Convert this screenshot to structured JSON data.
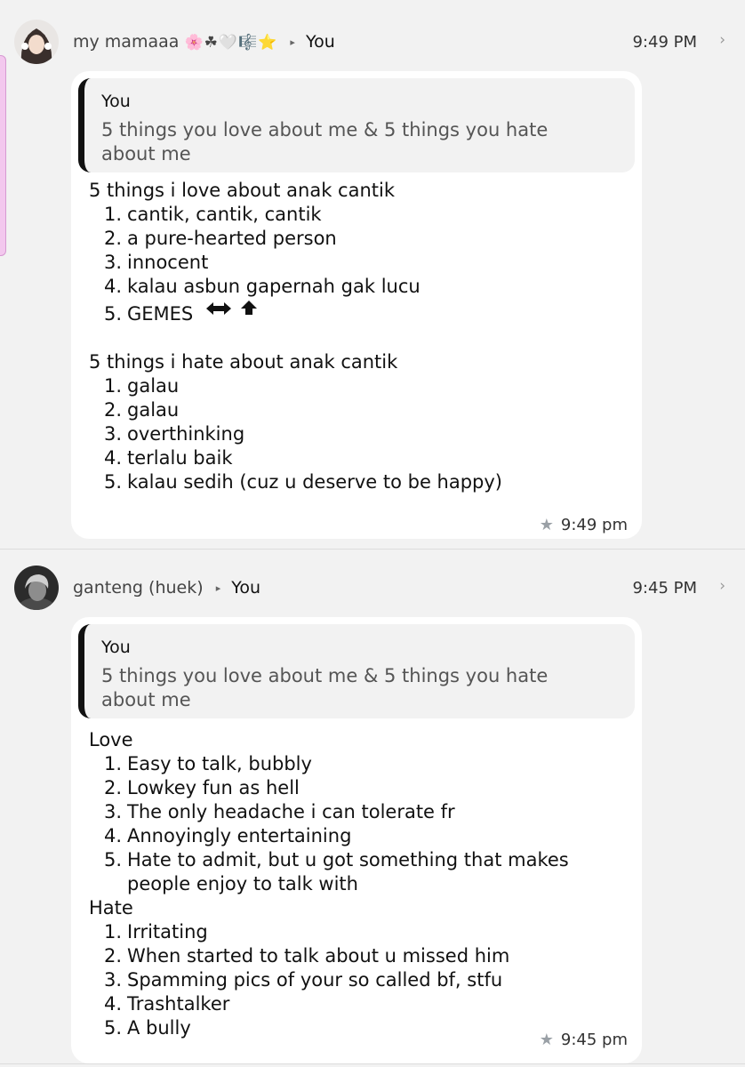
{
  "messages": [
    {
      "sender": "my mamaaa",
      "sender_emoji": "🌸☘🤍🎼⭐",
      "recipient": "You",
      "time": "9:49 PM",
      "quote": {
        "author": "You",
        "text": "5 things you love about me & 5 things you hate about me"
      },
      "sections": [
        {
          "heading": "5 things i love about anak cantik",
          "items": [
            "cantik, cantik, cantik",
            "a pure-hearted person",
            "innocent",
            "kalau asbun gapernah gak lucu",
            "GEMES"
          ]
        },
        {
          "heading": "5 things i hate about anak cantik",
          "items": [
            "galau",
            "galau",
            "overthinking",
            "terlalu baik",
            "kalau sedih (cuz u deserve to be happy)"
          ]
        }
      ],
      "emoji_badges": [
        "ON!",
        "TOP"
      ],
      "stamp_time": "9:49 pm"
    },
    {
      "sender": "ganteng (huek)",
      "recipient": "You",
      "time": "9:45 PM",
      "quote": {
        "author": "You",
        "text": "5 things you love about me & 5 things you hate about me"
      },
      "sections": [
        {
          "heading": "Love",
          "items": [
            "Easy to talk, bubbly",
            "Lowkey fun as hell",
            "The only headache i can tolerate fr",
            "Annoyingly entertaining",
            "Hate to admit, but u got something that makes people enjoy to talk with"
          ]
        },
        {
          "heading": "Hate",
          "items": [
            "Irritating",
            "When started to talk about u missed him",
            "Spamming pics of your so called bf, stfu",
            "Trashtalker",
            "A bully"
          ]
        }
      ],
      "stamp_time": "9:45 pm"
    }
  ],
  "list_numbers": [
    "1.",
    "2.",
    "3.",
    "4.",
    "5."
  ],
  "icons": {
    "star": "★",
    "chevron": "›",
    "recipient_arrow": "▸"
  },
  "colors": {
    "background": "#f2f2f2",
    "bubble": "#ffffff",
    "quote_bar": "#111111",
    "quote_bg": "#f2f2f2",
    "star": "#9aa0a6"
  }
}
